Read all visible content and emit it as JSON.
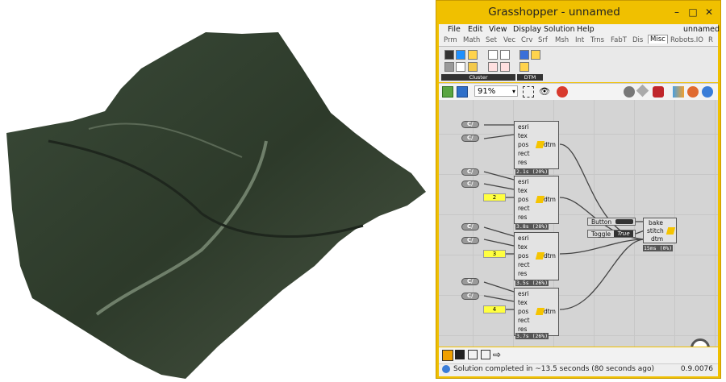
{
  "window": {
    "title": "Grasshopper - unnamed",
    "doc_name": "unnamed"
  },
  "menu": [
    "File",
    "Edit",
    "View",
    "Display",
    "Solution",
    "Help"
  ],
  "tabs": [
    "Prm",
    "Math",
    "Set",
    "Vec",
    "Crv",
    "Srf",
    "Msh",
    "Int",
    "Trns",
    "FabT",
    "Dis",
    "Misc",
    "Robots.IO",
    "R"
  ],
  "active_tab": "Misc",
  "ribbon": {
    "group1": "Cluster",
    "group2": "DTM"
  },
  "toolbar": {
    "zoom": "91%"
  },
  "components": [
    {
      "inputs": [
        "esri",
        "tex",
        "pos",
        "rect",
        "res"
      ],
      "output": "dtm",
      "status": "2.1s (20%)"
    },
    {
      "inputs": [
        "esri",
        "tex",
        "pos",
        "rect",
        "res"
      ],
      "output": "dtm",
      "status": "3.8s (28%)",
      "panel": "2"
    },
    {
      "inputs": [
        "esri",
        "tex",
        "pos",
        "rect",
        "res"
      ],
      "output": "dtm",
      "status": "3.5s (26%)",
      "panel": "3"
    },
    {
      "inputs": [
        "esri",
        "tex",
        "pos",
        "rect",
        "res"
      ],
      "output": "dtm",
      "status": "3.7s (26%)",
      "panel": "4"
    }
  ],
  "knob_label": "C/",
  "button": {
    "label": "Button"
  },
  "toggle": {
    "label": "Toggle",
    "value": "True"
  },
  "bake": {
    "inputs": [
      "bake",
      "stitch",
      "dtm"
    ],
    "status": "15ms (0%)"
  },
  "statusbar": {
    "message": "Solution completed in ~13.5 seconds (80 seconds ago)",
    "version": "0.9.0076"
  },
  "colors": {
    "window_frame": "#f0c000",
    "canvas": "#d4d4d4",
    "panel": "#ffff40"
  }
}
